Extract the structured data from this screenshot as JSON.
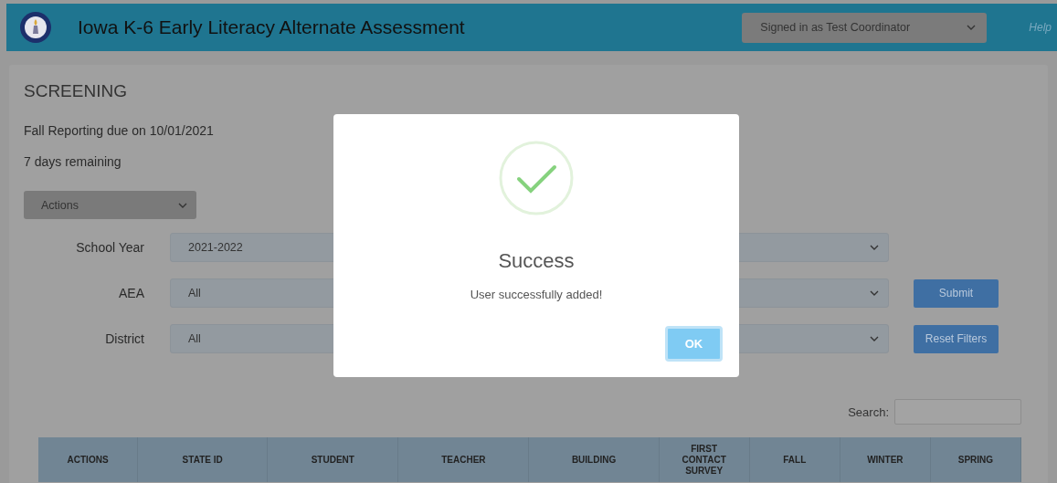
{
  "header": {
    "title": "Iowa K-6 Early Literacy Alternate Assessment",
    "user_menu": "Signed in as Test Coordinator",
    "help": "Help"
  },
  "page": {
    "title": "SCREENING",
    "due": "Fall Reporting due on 10/01/2021",
    "remaining": "7 days remaining",
    "actions": "Actions"
  },
  "filters": [
    {
      "label": "School Year",
      "value": "2021-2022"
    },
    {
      "label": "AEA",
      "value": "All",
      "button": "Submit"
    },
    {
      "label": "District",
      "value": "All",
      "button": "Reset Filters"
    }
  ],
  "search": {
    "label": "Search:"
  },
  "table": {
    "columns": [
      "ACTIONS",
      "STATE ID",
      "STUDENT",
      "TEACHER",
      "BUILDING",
      "FIRST CONTACT SURVEY",
      "FALL",
      "WINTER",
      "SPRING"
    ]
  },
  "modal": {
    "title": "Success",
    "message": "User successfully added!",
    "button": "OK"
  }
}
